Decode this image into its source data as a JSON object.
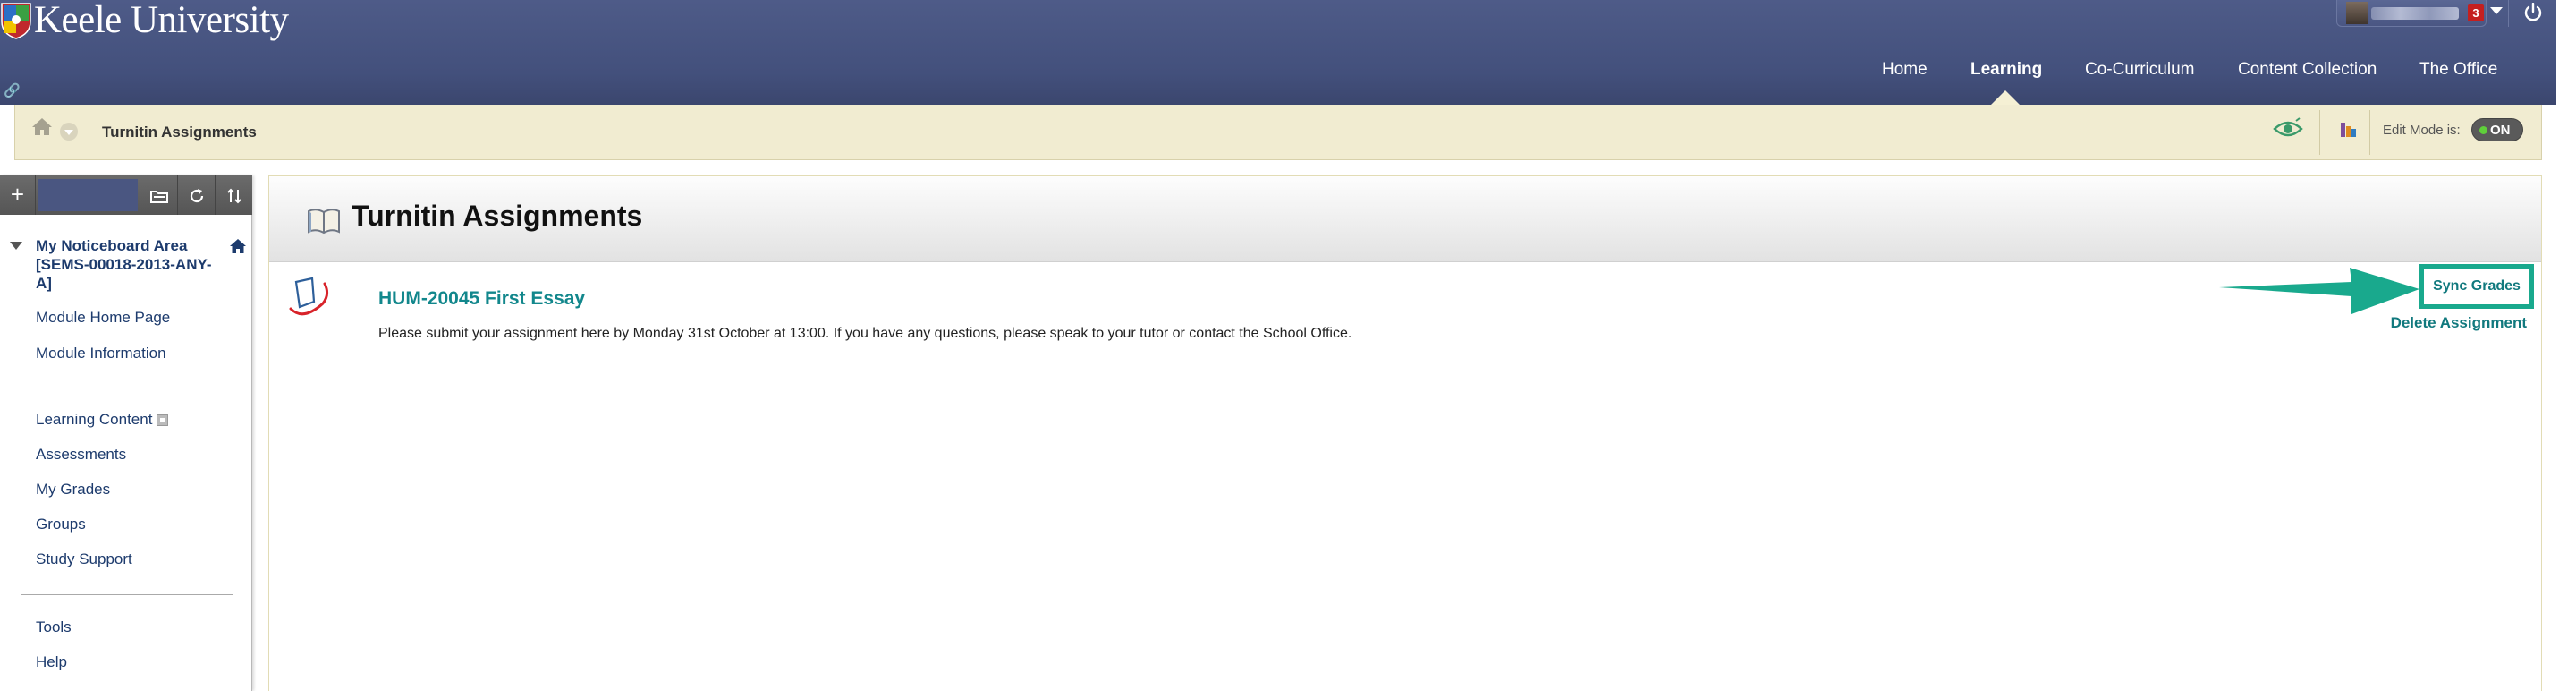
{
  "header": {
    "university_name": "Keele University",
    "notification_count": "3",
    "nav": [
      "Home",
      "Learning",
      "Co-Curriculum",
      "Content Collection",
      "The Office"
    ],
    "active_nav": "Learning"
  },
  "breadcrumb": {
    "title": "Turnitin Assignments",
    "edit_mode_label": "Edit Mode is:",
    "edit_mode_state": "ON"
  },
  "sidebar": {
    "course_title": "My Noticeboard Area [SEMS-00018-2013-ANY-A]",
    "group1": [
      "Module Home Page",
      "Module Information"
    ],
    "group2": [
      "Learning Content",
      "Assessments",
      "My Grades",
      "Groups",
      "Study Support"
    ],
    "group3": [
      "Tools",
      "Help"
    ]
  },
  "main": {
    "page_title": "Turnitin Assignments",
    "assignment": {
      "title": "HUM-20045 First Essay",
      "description": "Please submit your assignment here by Monday 31st October at 13:00. If you have any questions, please speak to your tutor or contact the School Office.",
      "sync_label": "Sync Grades",
      "delete_label": "Delete Assignment"
    }
  },
  "colors": {
    "header_bg": "#4a5682",
    "crumb_bg": "#f1ecd1",
    "link_teal": "#12878c",
    "highlight_green": "#19a98d",
    "sidebar_link": "#1d3b6d"
  },
  "icons": [
    "keele-crest-icon",
    "link-icon",
    "power-icon",
    "home-icon",
    "eye-icon",
    "chart-icon",
    "add-icon",
    "folder-icon",
    "refresh-icon",
    "sort-icon",
    "book-icon",
    "turnitin-icon",
    "arrow-icon"
  ]
}
